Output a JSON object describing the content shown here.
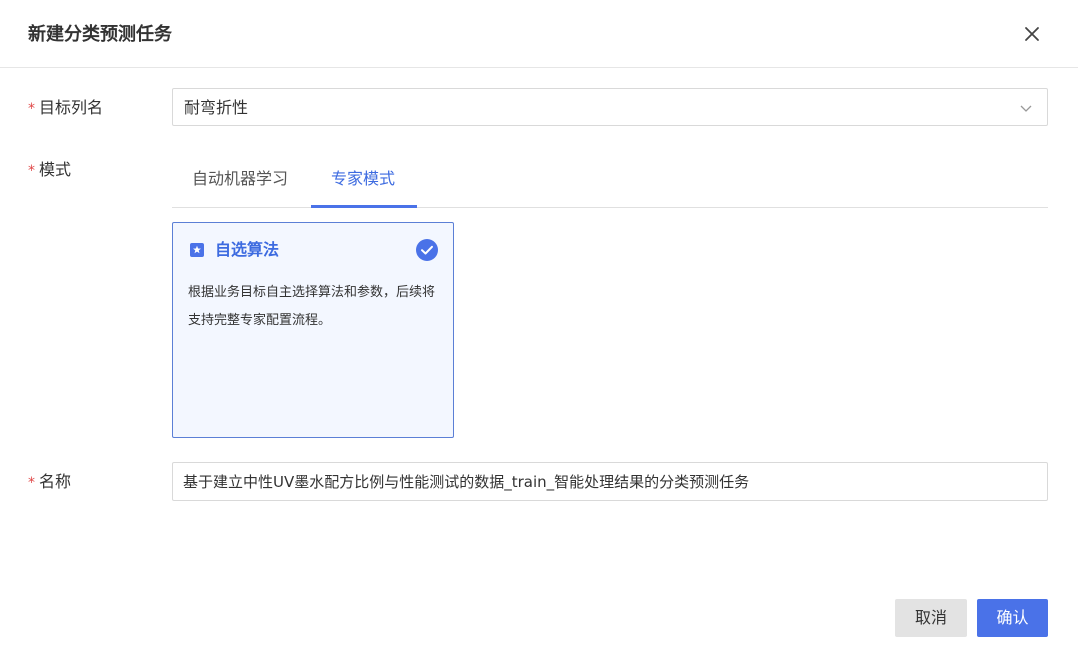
{
  "dialog": {
    "title": "新建分类预测任务"
  },
  "form": {
    "required_mark": "*",
    "target_label": "目标列名",
    "target_value": "耐弯折性",
    "mode_label": "模式",
    "name_label": "名称",
    "name_value": "基于建立中性UV墨水配方比例与性能测试的数据_train_智能处理结果的分类预测任务"
  },
  "tabs": [
    {
      "label": "自动机器学习",
      "active": false
    },
    {
      "label": "专家模式",
      "active": true
    }
  ],
  "card": {
    "title": "自选算法",
    "description": "根据业务目标自主选择算法和参数，后续将支持完整专家配置流程。",
    "selected": true,
    "icon": "star-square-icon"
  },
  "buttons": {
    "cancel": "取消",
    "confirm": "确认"
  },
  "colors": {
    "accent": "#4a72e8",
    "required": "#e04848",
    "card_bg": "#f3f7ff"
  }
}
